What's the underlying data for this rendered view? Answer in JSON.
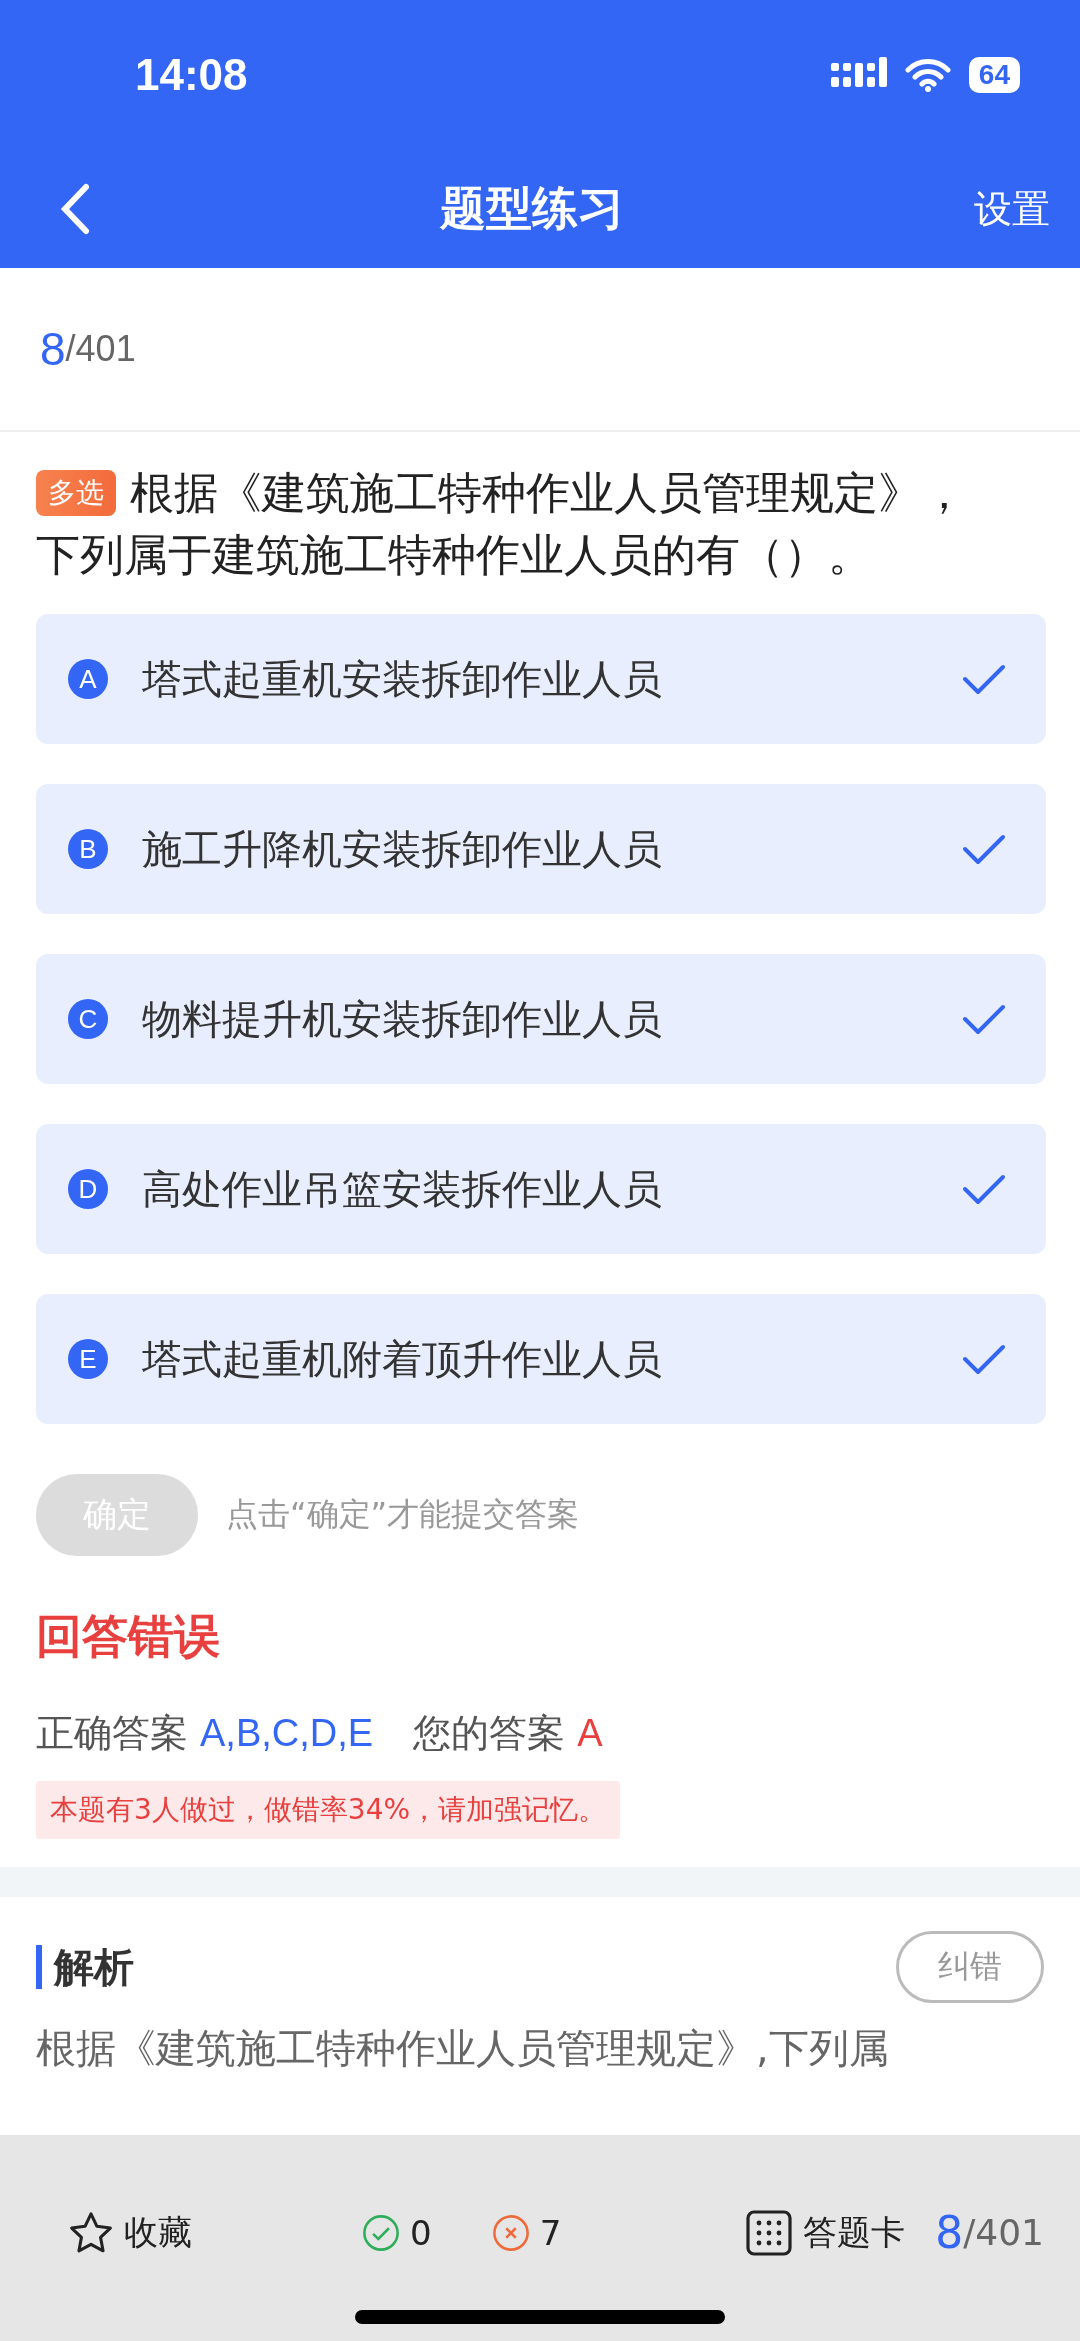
{
  "status_bar": {
    "time": "14:08",
    "battery": "64"
  },
  "header": {
    "title": "题型练习",
    "action": "设置"
  },
  "progress": {
    "current": "8",
    "total": "/401"
  },
  "question": {
    "type_tag": "多选",
    "lines": [
      "根据《建筑施工特种作业人员管理规定》，",
      "下列属于建筑施工特种作业人员的有（）。"
    ]
  },
  "options": [
    {
      "letter": "A",
      "text": "塔式起重机安装拆卸作业人员",
      "checked": true
    },
    {
      "letter": "B",
      "text": "施工升降机安装拆卸作业人员",
      "checked": true
    },
    {
      "letter": "C",
      "text": "物料提升机安装拆卸作业人员",
      "checked": true
    },
    {
      "letter": "D",
      "text": "高处作业吊篮安装拆作业人员",
      "checked": true
    },
    {
      "letter": "E",
      "text": "塔式起重机附着顶升作业人员",
      "checked": true
    }
  ],
  "confirm": {
    "label": "确定",
    "disabled": true,
    "hint": "点击“确定”才能提交答案"
  },
  "result": {
    "verdict": "回答错误",
    "correct_label": "正确答案",
    "correct_value": "A,B,C,D,E",
    "your_label": "您的答案",
    "your_value": "A",
    "note": "本题有3人做过，做错率34%，请加强记忆。"
  },
  "analysis": {
    "title": "解析",
    "report_button": "纠错",
    "text": "根据《建筑施工特种作业人员管理规定》,下列属"
  },
  "bottom_bar": {
    "favorite": "收藏",
    "right_count": "0",
    "wrong_count": "7",
    "answer_card": "答题卡",
    "current": "8",
    "total": "/401"
  }
}
